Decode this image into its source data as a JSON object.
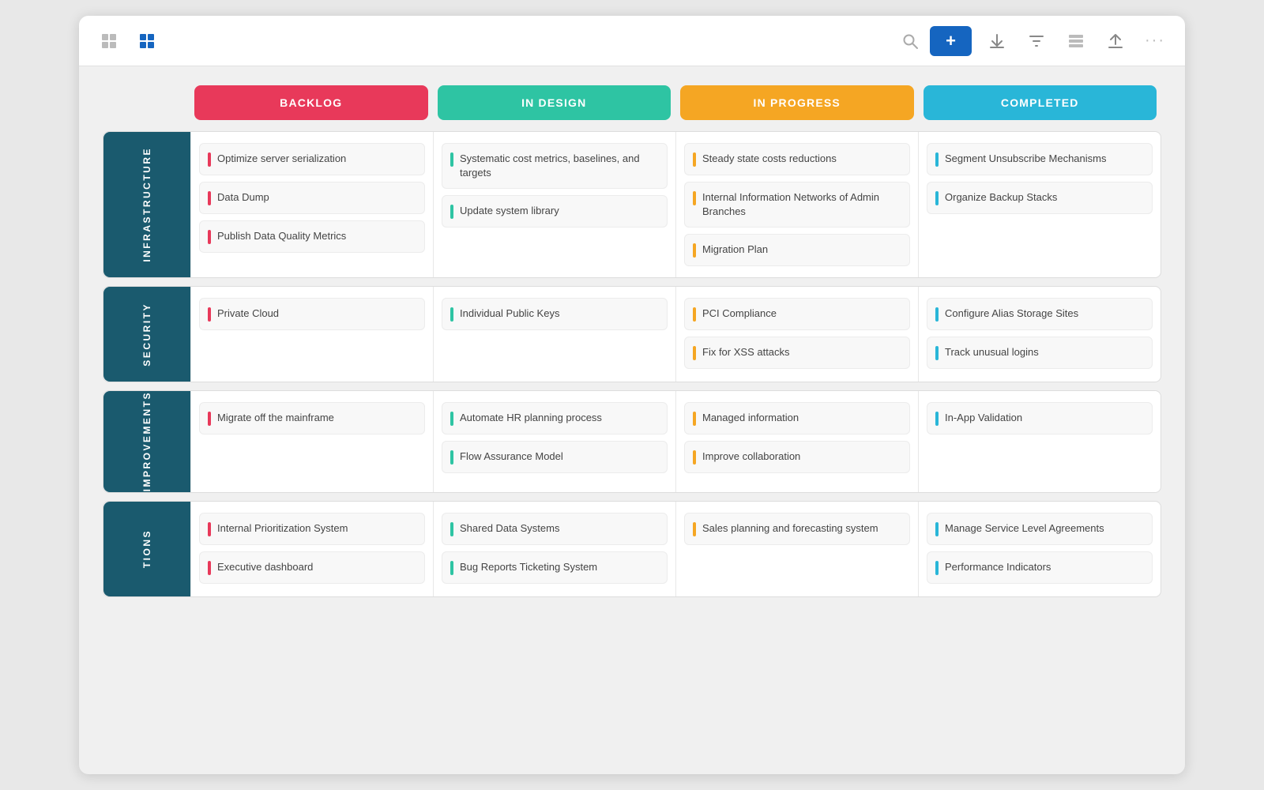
{
  "toolbar": {
    "add_label": "+",
    "search_placeholder": "Search",
    "icons": {
      "table": "⊞",
      "grid": "⊟",
      "search": "🔍",
      "download": "⬇",
      "filter": "⧩",
      "layout": "▤",
      "upload": "⬆",
      "more": "···"
    }
  },
  "columns": [
    {
      "id": "backlog",
      "label": "BACKLOG",
      "class": "backlog"
    },
    {
      "id": "in-design",
      "label": "IN DESIGN",
      "class": "in-design"
    },
    {
      "id": "in-progress",
      "label": "IN PROGRESS",
      "class": "in-progress"
    },
    {
      "id": "completed",
      "label": "COMPLETED",
      "class": "completed"
    }
  ],
  "rows": [
    {
      "id": "infrastructure",
      "label": "INFRASTRUCTURE",
      "cells": {
        "backlog": [
          "Optimize server serialization",
          "Data Dump",
          "Publish Data Quality Metrics"
        ],
        "in-design": [
          "Systematic cost metrics, baselines, and targets",
          "Update system library"
        ],
        "in-progress": [
          "Steady state costs reductions",
          "Internal Information Networks of Admin Branches",
          "Migration Plan"
        ],
        "completed": [
          "Segment Unsubscribe Mechanisms",
          "Organize Backup Stacks"
        ]
      }
    },
    {
      "id": "security",
      "label": "SECURITY",
      "cells": {
        "backlog": [
          "Private Cloud"
        ],
        "in-design": [
          "Individual Public Keys"
        ],
        "in-progress": [
          "PCI Compliance",
          "Fix for XSS attacks"
        ],
        "completed": [
          "Configure Alias Storage Sites",
          "Track unusual logins"
        ]
      }
    },
    {
      "id": "improvements",
      "label": "IMPROVEMENTS",
      "cells": {
        "backlog": [
          "Migrate off the mainframe"
        ],
        "in-design": [
          "Automate HR planning process",
          "Flow Assurance Model"
        ],
        "in-progress": [
          "Managed information",
          "Improve collaboration"
        ],
        "completed": [
          "In-App Validation"
        ]
      }
    },
    {
      "id": "tions",
      "label": "TIONS",
      "cells": {
        "backlog": [
          "Internal Prioritization System",
          "Executive dashboard"
        ],
        "in-design": [
          "Shared Data Systems",
          "Bug Reports Ticketing System"
        ],
        "in-progress": [
          "Sales planning and forecasting system"
        ],
        "completed": [
          "Manage Service Level Agreements",
          "Performance Indicators"
        ]
      }
    }
  ]
}
